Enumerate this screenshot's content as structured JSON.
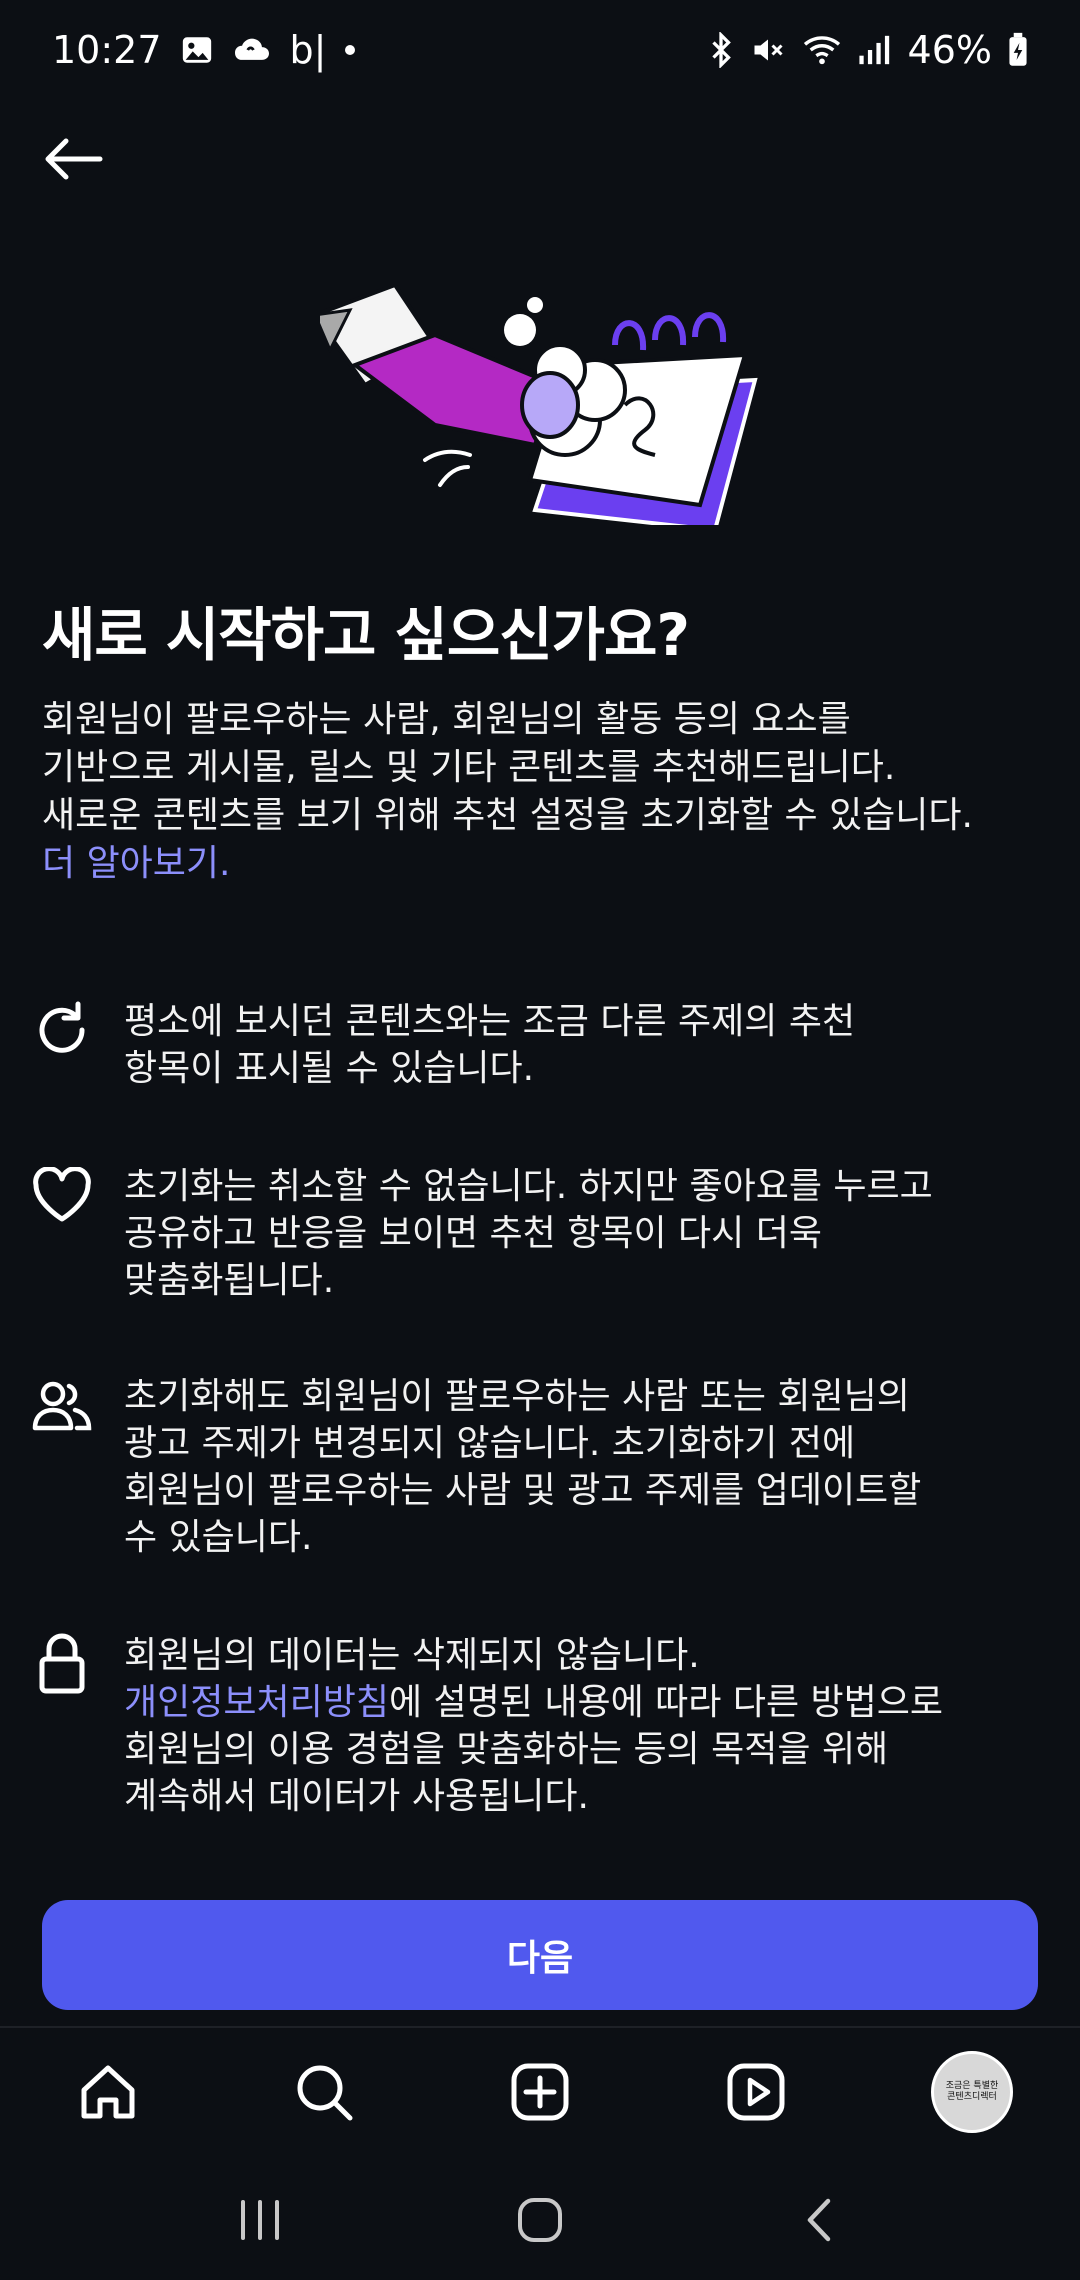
{
  "status_bar": {
    "time": "10:27",
    "carrier_text": "b|",
    "battery": "46%",
    "icons": [
      "gallery-icon",
      "cloud-icon",
      "dot-icon",
      "bluetooth-icon",
      "mute-icon",
      "wifi-icon",
      "signal-icon",
      "battery-icon"
    ]
  },
  "header": {
    "back_icon": "arrow-left-icon"
  },
  "main": {
    "title": "새로 시작하고 싶으신가요?",
    "description_lines": [
      "회원님이 팔로우하는 사람, 회원님의 활동 등의 요소를",
      "기반으로 게시물, 릴스 및 기타 콘텐츠를 추천해드립니다.",
      "새로운 콘텐츠를 보기 위해 추천 설정을 초기화할 수 있습니다."
    ],
    "learn_more": "더 알아보기.",
    "items": [
      {
        "icon": "refresh-icon",
        "lines": [
          "평소에 보시던 콘텐츠와는 조금 다른 주제의 추천",
          "항목이 표시될 수 있습니다."
        ]
      },
      {
        "icon": "heart-icon",
        "lines": [
          "초기화는 취소할 수 없습니다. 하지만 좋아요를 누르고",
          "공유하고 반응을 보이면 추천 항목이 다시 더욱",
          "맞춤화됩니다."
        ]
      },
      {
        "icon": "people-icon",
        "lines": [
          "초기화해도 회원님이 팔로우하는 사람 또는 회원님의",
          "광고 주제가 변경되지 않습니다. 초기화하기 전에",
          "회원님이 팔로우하는 사람 및 광고 주제를 업데이트할",
          "수 있습니다."
        ]
      },
      {
        "icon": "lock-icon",
        "line1": "회원님의 데이터는 삭제되지 않습니다.",
        "link": "개인정보처리방침",
        "line2_rest": "에 설명된 내용에 따라 다른 방법으로",
        "line3": "회원님의 이용 경험을 맞춤화하는 등의 목적을 위해",
        "line4": "계속해서 데이터가 사용됩니다."
      }
    ],
    "next_button": "다음"
  },
  "tab_bar": {
    "items": [
      "home-icon",
      "search-icon",
      "create-icon",
      "reels-icon",
      "profile-avatar"
    ],
    "avatar_text": [
      "조금은 특별한",
      "콘텐츠디렉터"
    ]
  },
  "colors": {
    "background": "#0c0f14",
    "accent": "#5059ee",
    "link": "#8c8ffb"
  }
}
